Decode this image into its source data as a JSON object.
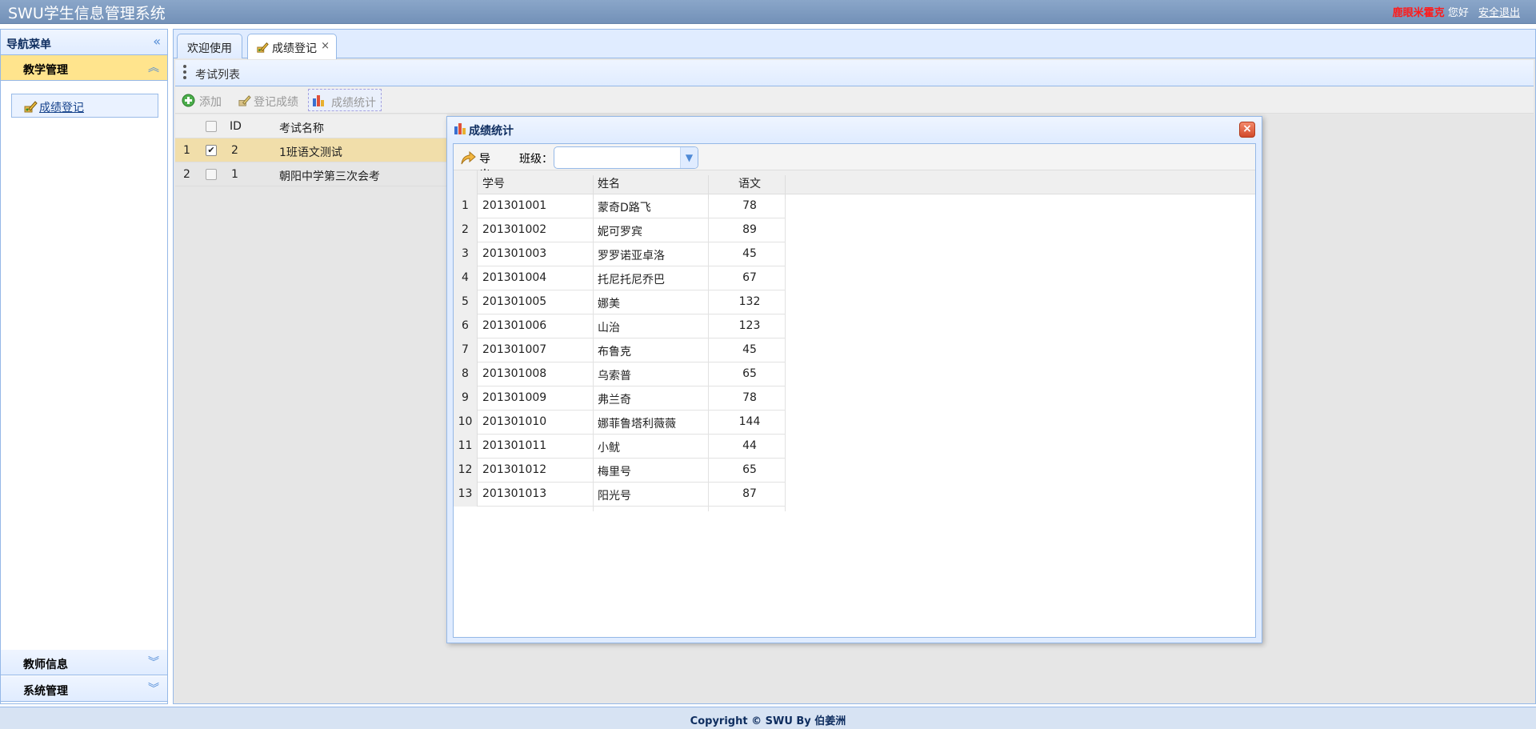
{
  "header": {
    "title": "SWU学生信息管理系统",
    "username": "鹿眼米霍克",
    "greeting": "您好",
    "logout": "安全退出"
  },
  "nav": {
    "title": "导航菜单",
    "sections": [
      {
        "label": "教学管理",
        "expanded": true,
        "items": [
          {
            "label": "成绩登记"
          }
        ]
      },
      {
        "label": "教师信息",
        "expanded": false
      },
      {
        "label": "系统管理",
        "expanded": false
      }
    ]
  },
  "tabs": [
    {
      "label": "欢迎使用"
    },
    {
      "label": "成绩登记",
      "closable": true,
      "close_symbol": "×"
    }
  ],
  "exam_list": {
    "title": "考试列表",
    "toolbar": {
      "add": "添加",
      "register": "登记成绩",
      "stats": "成绩统计"
    },
    "columns": [
      "ID",
      "考试名称"
    ],
    "rows": [
      {
        "num": "1",
        "checked": true,
        "id": "2",
        "name": "1班语文测试"
      },
      {
        "num": "2",
        "checked": false,
        "id": "1",
        "name": "朝阳中学第三次会考"
      }
    ]
  },
  "dialog": {
    "title": "成绩统计",
    "export": "导出",
    "class_label": "班级：",
    "class_value": "",
    "columns": [
      "学号",
      "姓名",
      "语文"
    ],
    "rows": [
      {
        "num": "1",
        "sid": "201301001",
        "name": "蒙奇D路飞",
        "score": "78"
      },
      {
        "num": "2",
        "sid": "201301002",
        "name": "妮可罗宾",
        "score": "89"
      },
      {
        "num": "3",
        "sid": "201301003",
        "name": "罗罗诺亚卓洛",
        "score": "45"
      },
      {
        "num": "4",
        "sid": "201301004",
        "name": "托尼托尼乔巴",
        "score": "67"
      },
      {
        "num": "5",
        "sid": "201301005",
        "name": "娜美",
        "score": "132"
      },
      {
        "num": "6",
        "sid": "201301006",
        "name": "山治",
        "score": "123"
      },
      {
        "num": "7",
        "sid": "201301007",
        "name": "布鲁克",
        "score": "45"
      },
      {
        "num": "8",
        "sid": "201301008",
        "name": "乌索普",
        "score": "65"
      },
      {
        "num": "9",
        "sid": "201301009",
        "name": "弗兰奇",
        "score": "78"
      },
      {
        "num": "10",
        "sid": "201301010",
        "name": "娜菲鲁塔利薇薇",
        "score": "144"
      },
      {
        "num": "11",
        "sid": "201301011",
        "name": "小鱿",
        "score": "44"
      },
      {
        "num": "12",
        "sid": "201301012",
        "name": "梅里号",
        "score": "65"
      },
      {
        "num": "13",
        "sid": "201301013",
        "name": "阳光号",
        "score": "87"
      }
    ]
  },
  "footer": {
    "text": "Copyright © SWU By 伯姜洲"
  },
  "colors": {
    "header_bg": "#7f9cc1",
    "selected_row": "#f1deaa",
    "active_section": "#ffe48d",
    "username": "#ff1a1a"
  }
}
